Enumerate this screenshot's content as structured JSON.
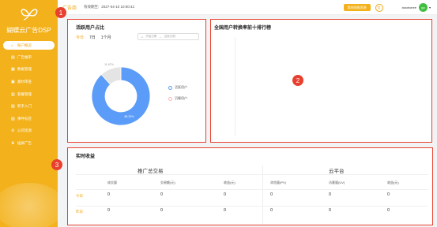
{
  "sidebar": {
    "brand": "蝴蝶云广告DSP",
    "items": [
      {
        "icon": "home-icon",
        "glyph": "⌂",
        "label": "账户概览",
        "active": true
      },
      {
        "icon": "ad-icon",
        "glyph": "▤",
        "label": "广告推审"
      },
      {
        "icon": "data-icon",
        "glyph": "▦",
        "label": "数据管理"
      },
      {
        "icon": "material-icon",
        "glyph": "▣",
        "label": "素材审查"
      },
      {
        "icon": "finance-icon",
        "glyph": "▥",
        "label": "套餐管理"
      },
      {
        "icon": "group-icon",
        "glyph": "▧",
        "label": "新手入门"
      },
      {
        "icon": "package-icon",
        "glyph": "▨",
        "label": "事件标签"
      },
      {
        "icon": "settings-icon",
        "glyph": "⚙",
        "label": "公司资源"
      },
      {
        "icon": "crown-icon",
        "glyph": "♛",
        "label": "插屏广告"
      }
    ]
  },
  "topbar": {
    "title": "广告商",
    "validity_label": "有效期至:",
    "validity_date": "2027-04-10 10:00:42",
    "upgrade_label": "我的网络资源",
    "bell_text": "信",
    "username": "xiaohonee",
    "avatar_text": "go"
  },
  "active_users": {
    "title": "活跃用户占比",
    "ranges": [
      "今日",
      "7日",
      "1个月"
    ],
    "date_start_placeholder": "开始日期",
    "date_sep": "—",
    "date_end_placeholder": "结束日期",
    "legend": [
      "活跃用户",
      "沉睡用户"
    ],
    "label_active": "88.33%",
    "label_new": "11.67%",
    "badge": "1"
  },
  "chart_data": {
    "type": "pie",
    "title": "活跃用户占比",
    "categories": [
      "活跃用户",
      "沉睡用户"
    ],
    "values": [
      88.33,
      11.67
    ],
    "colors": [
      "#5a9cf8",
      "#e4e4e4"
    ],
    "legend_position": "right"
  },
  "ranking": {
    "title": "全国用户转换率前十排行榜",
    "badge": "2"
  },
  "earnings": {
    "title": "实时收益",
    "badge": "3",
    "section_a": "推广总交易",
    "section_b": "云平台",
    "columns": [
      "成交量",
      "交易额(元)",
      "收益(元)",
      "浏览量(PV)",
      "访客量(UV)",
      "收益(元)"
    ],
    "rows": [
      {
        "label": "今日",
        "values": [
          "0",
          "0",
          "0",
          "0",
          "0",
          "0"
        ]
      },
      {
        "label": "昨日",
        "values": [
          "0",
          "0",
          "0",
          "0",
          "0",
          "0"
        ]
      }
    ]
  }
}
